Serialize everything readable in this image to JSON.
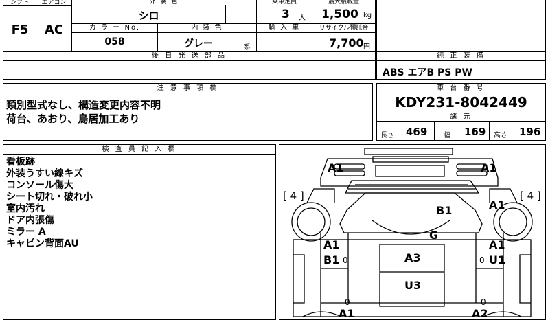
{
  "top": {
    "shift_label": "シフト",
    "shift": "F5",
    "aircon_label": "エアコン",
    "aircon": "AC",
    "exterior_color_label": "外 装 色",
    "exterior_color": "シロ",
    "capacity_label": "乗車定員",
    "capacity": "3",
    "capacity_unit": "人",
    "max_load_label": "最大積載量",
    "max_load": "1,500",
    "max_load_unit": "kg",
    "color_no_label": "カ ラ ー No.",
    "color_no": "058",
    "interior_color_label": "内 装 色",
    "interior_color": "グレー",
    "interior_suffix": "系",
    "import_label": "輸 入 車",
    "recycle_label": "リサイクル預託金",
    "recycle_fee": "7,700",
    "recycle_unit": "円"
  },
  "later_parts": {
    "header": "後 日 発 送 部 品"
  },
  "genuine": {
    "header": "純 正 装 備",
    "items": "ABS エアB PS PW"
  },
  "notes": {
    "header": "注 意 事 項 欄",
    "line1": "類別型式なし、構造変更内容不明",
    "line2": "荷台、あおり、鳥居加工あり"
  },
  "chassis": {
    "header": "車 台 番 号",
    "number": "KDY231-8042449",
    "specs_header": "諸 元",
    "length_label": "長さ",
    "length": "469",
    "width_label": "幅",
    "width": "169",
    "height_label": "高さ",
    "height": "196"
  },
  "inspector": {
    "header": "検 査 員 記 入 欄",
    "lines": [
      "看板跡",
      "外装うすい線キズ",
      "コンソール傷大",
      "シート切れ・破れ小",
      "室内汚れ",
      "ドア内張傷",
      "ミラー A",
      "キャビン背面AU"
    ]
  },
  "diagram": {
    "marks": {
      "front_left": "A1",
      "front_right": "A1",
      "left_bracket": "[ 4 ]",
      "right_bracket": "[ 4 ]",
      "hood": "B1",
      "right_fender": "A1",
      "roof": "G",
      "left_door_1": "A1",
      "left_door_2": "B1",
      "left_door_zero": "0",
      "right_door_1": "A1",
      "right_door_2": "U1",
      "right_door_zero": "0",
      "cabin": "A3",
      "cabin_rear": "U3",
      "bottom_left_zero": "0",
      "bottom_right_zero": "0",
      "bottom_left": "A1",
      "bottom_right": "A2"
    }
  }
}
